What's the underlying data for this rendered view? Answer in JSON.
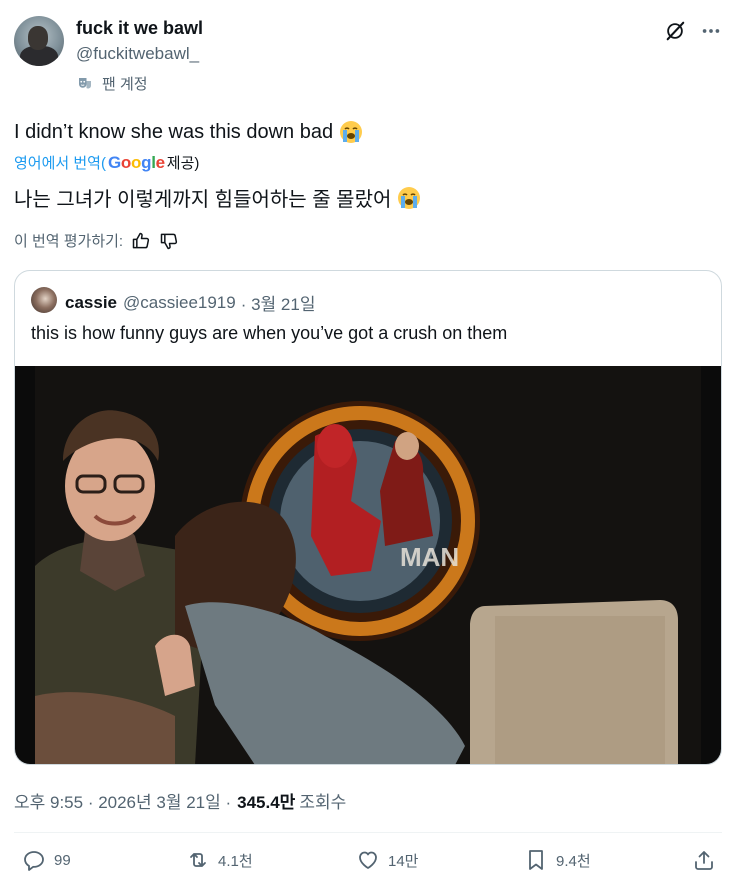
{
  "author": {
    "display_name": "fuck it we bawl",
    "handle": "@fuckitwebawl_",
    "badge_label": "팬 계정"
  },
  "tweet": {
    "text": "I didn’t know she was this down bad",
    "text_emoji": "loudly-crying-face",
    "translation": {
      "prefix": "영어에서 번역(",
      "provider": "Google",
      "suffix": "제공)",
      "text": "나는 그녀가 이렇게까지 힘들어하는 줄 몰랐어"
    },
    "rate_label": "이 번역 평가하기:"
  },
  "quote": {
    "name": "cassie",
    "handle": "@cassiee1919",
    "date": "· 3월 21일",
    "text": "this is how funny guys are when you’ve got a crush on them"
  },
  "meta": {
    "time_date": "오후 9:55 · 2026년 3월 21일 ·",
    "views_count": "345.4만",
    "views_label": "조회수"
  },
  "actions": {
    "replies": "99",
    "reposts": "4.1천",
    "likes": "14만",
    "bookmarks": "9.4천"
  },
  "colors": {
    "text_primary": "#0f1419",
    "text_secondary": "#536471",
    "accent": "#1d9bf0",
    "border": "#cfd9de"
  }
}
